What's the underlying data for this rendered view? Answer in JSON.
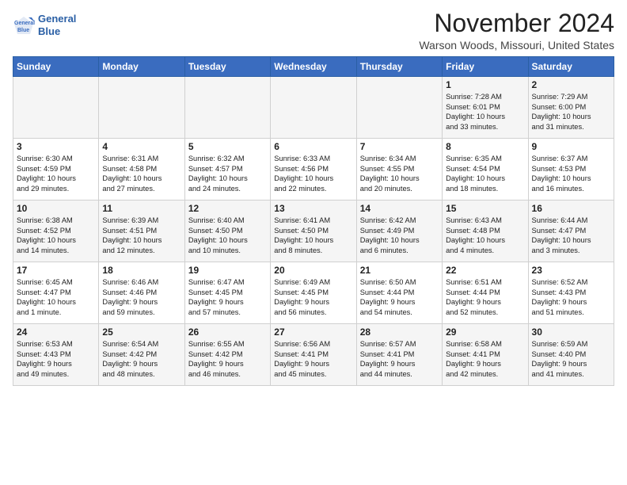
{
  "header": {
    "logo_line1": "General",
    "logo_line2": "Blue",
    "month": "November 2024",
    "location": "Warson Woods, Missouri, United States"
  },
  "weekdays": [
    "Sunday",
    "Monday",
    "Tuesday",
    "Wednesday",
    "Thursday",
    "Friday",
    "Saturday"
  ],
  "weeks": [
    [
      {
        "day": "",
        "text": ""
      },
      {
        "day": "",
        "text": ""
      },
      {
        "day": "",
        "text": ""
      },
      {
        "day": "",
        "text": ""
      },
      {
        "day": "",
        "text": ""
      },
      {
        "day": "1",
        "text": "Sunrise: 7:28 AM\nSunset: 6:01 PM\nDaylight: 10 hours\nand 33 minutes."
      },
      {
        "day": "2",
        "text": "Sunrise: 7:29 AM\nSunset: 6:00 PM\nDaylight: 10 hours\nand 31 minutes."
      }
    ],
    [
      {
        "day": "3",
        "text": "Sunrise: 6:30 AM\nSunset: 4:59 PM\nDaylight: 10 hours\nand 29 minutes."
      },
      {
        "day": "4",
        "text": "Sunrise: 6:31 AM\nSunset: 4:58 PM\nDaylight: 10 hours\nand 27 minutes."
      },
      {
        "day": "5",
        "text": "Sunrise: 6:32 AM\nSunset: 4:57 PM\nDaylight: 10 hours\nand 24 minutes."
      },
      {
        "day": "6",
        "text": "Sunrise: 6:33 AM\nSunset: 4:56 PM\nDaylight: 10 hours\nand 22 minutes."
      },
      {
        "day": "7",
        "text": "Sunrise: 6:34 AM\nSunset: 4:55 PM\nDaylight: 10 hours\nand 20 minutes."
      },
      {
        "day": "8",
        "text": "Sunrise: 6:35 AM\nSunset: 4:54 PM\nDaylight: 10 hours\nand 18 minutes."
      },
      {
        "day": "9",
        "text": "Sunrise: 6:37 AM\nSunset: 4:53 PM\nDaylight: 10 hours\nand 16 minutes."
      }
    ],
    [
      {
        "day": "10",
        "text": "Sunrise: 6:38 AM\nSunset: 4:52 PM\nDaylight: 10 hours\nand 14 minutes."
      },
      {
        "day": "11",
        "text": "Sunrise: 6:39 AM\nSunset: 4:51 PM\nDaylight: 10 hours\nand 12 minutes."
      },
      {
        "day": "12",
        "text": "Sunrise: 6:40 AM\nSunset: 4:50 PM\nDaylight: 10 hours\nand 10 minutes."
      },
      {
        "day": "13",
        "text": "Sunrise: 6:41 AM\nSunset: 4:50 PM\nDaylight: 10 hours\nand 8 minutes."
      },
      {
        "day": "14",
        "text": "Sunrise: 6:42 AM\nSunset: 4:49 PM\nDaylight: 10 hours\nand 6 minutes."
      },
      {
        "day": "15",
        "text": "Sunrise: 6:43 AM\nSunset: 4:48 PM\nDaylight: 10 hours\nand 4 minutes."
      },
      {
        "day": "16",
        "text": "Sunrise: 6:44 AM\nSunset: 4:47 PM\nDaylight: 10 hours\nand 3 minutes."
      }
    ],
    [
      {
        "day": "17",
        "text": "Sunrise: 6:45 AM\nSunset: 4:47 PM\nDaylight: 10 hours\nand 1 minute."
      },
      {
        "day": "18",
        "text": "Sunrise: 6:46 AM\nSunset: 4:46 PM\nDaylight: 9 hours\nand 59 minutes."
      },
      {
        "day": "19",
        "text": "Sunrise: 6:47 AM\nSunset: 4:45 PM\nDaylight: 9 hours\nand 57 minutes."
      },
      {
        "day": "20",
        "text": "Sunrise: 6:49 AM\nSunset: 4:45 PM\nDaylight: 9 hours\nand 56 minutes."
      },
      {
        "day": "21",
        "text": "Sunrise: 6:50 AM\nSunset: 4:44 PM\nDaylight: 9 hours\nand 54 minutes."
      },
      {
        "day": "22",
        "text": "Sunrise: 6:51 AM\nSunset: 4:44 PM\nDaylight: 9 hours\nand 52 minutes."
      },
      {
        "day": "23",
        "text": "Sunrise: 6:52 AM\nSunset: 4:43 PM\nDaylight: 9 hours\nand 51 minutes."
      }
    ],
    [
      {
        "day": "24",
        "text": "Sunrise: 6:53 AM\nSunset: 4:43 PM\nDaylight: 9 hours\nand 49 minutes."
      },
      {
        "day": "25",
        "text": "Sunrise: 6:54 AM\nSunset: 4:42 PM\nDaylight: 9 hours\nand 48 minutes."
      },
      {
        "day": "26",
        "text": "Sunrise: 6:55 AM\nSunset: 4:42 PM\nDaylight: 9 hours\nand 46 minutes."
      },
      {
        "day": "27",
        "text": "Sunrise: 6:56 AM\nSunset: 4:41 PM\nDaylight: 9 hours\nand 45 minutes."
      },
      {
        "day": "28",
        "text": "Sunrise: 6:57 AM\nSunset: 4:41 PM\nDaylight: 9 hours\nand 44 minutes."
      },
      {
        "day": "29",
        "text": "Sunrise: 6:58 AM\nSunset: 4:41 PM\nDaylight: 9 hours\nand 42 minutes."
      },
      {
        "day": "30",
        "text": "Sunrise: 6:59 AM\nSunset: 4:40 PM\nDaylight: 9 hours\nand 41 minutes."
      }
    ]
  ]
}
